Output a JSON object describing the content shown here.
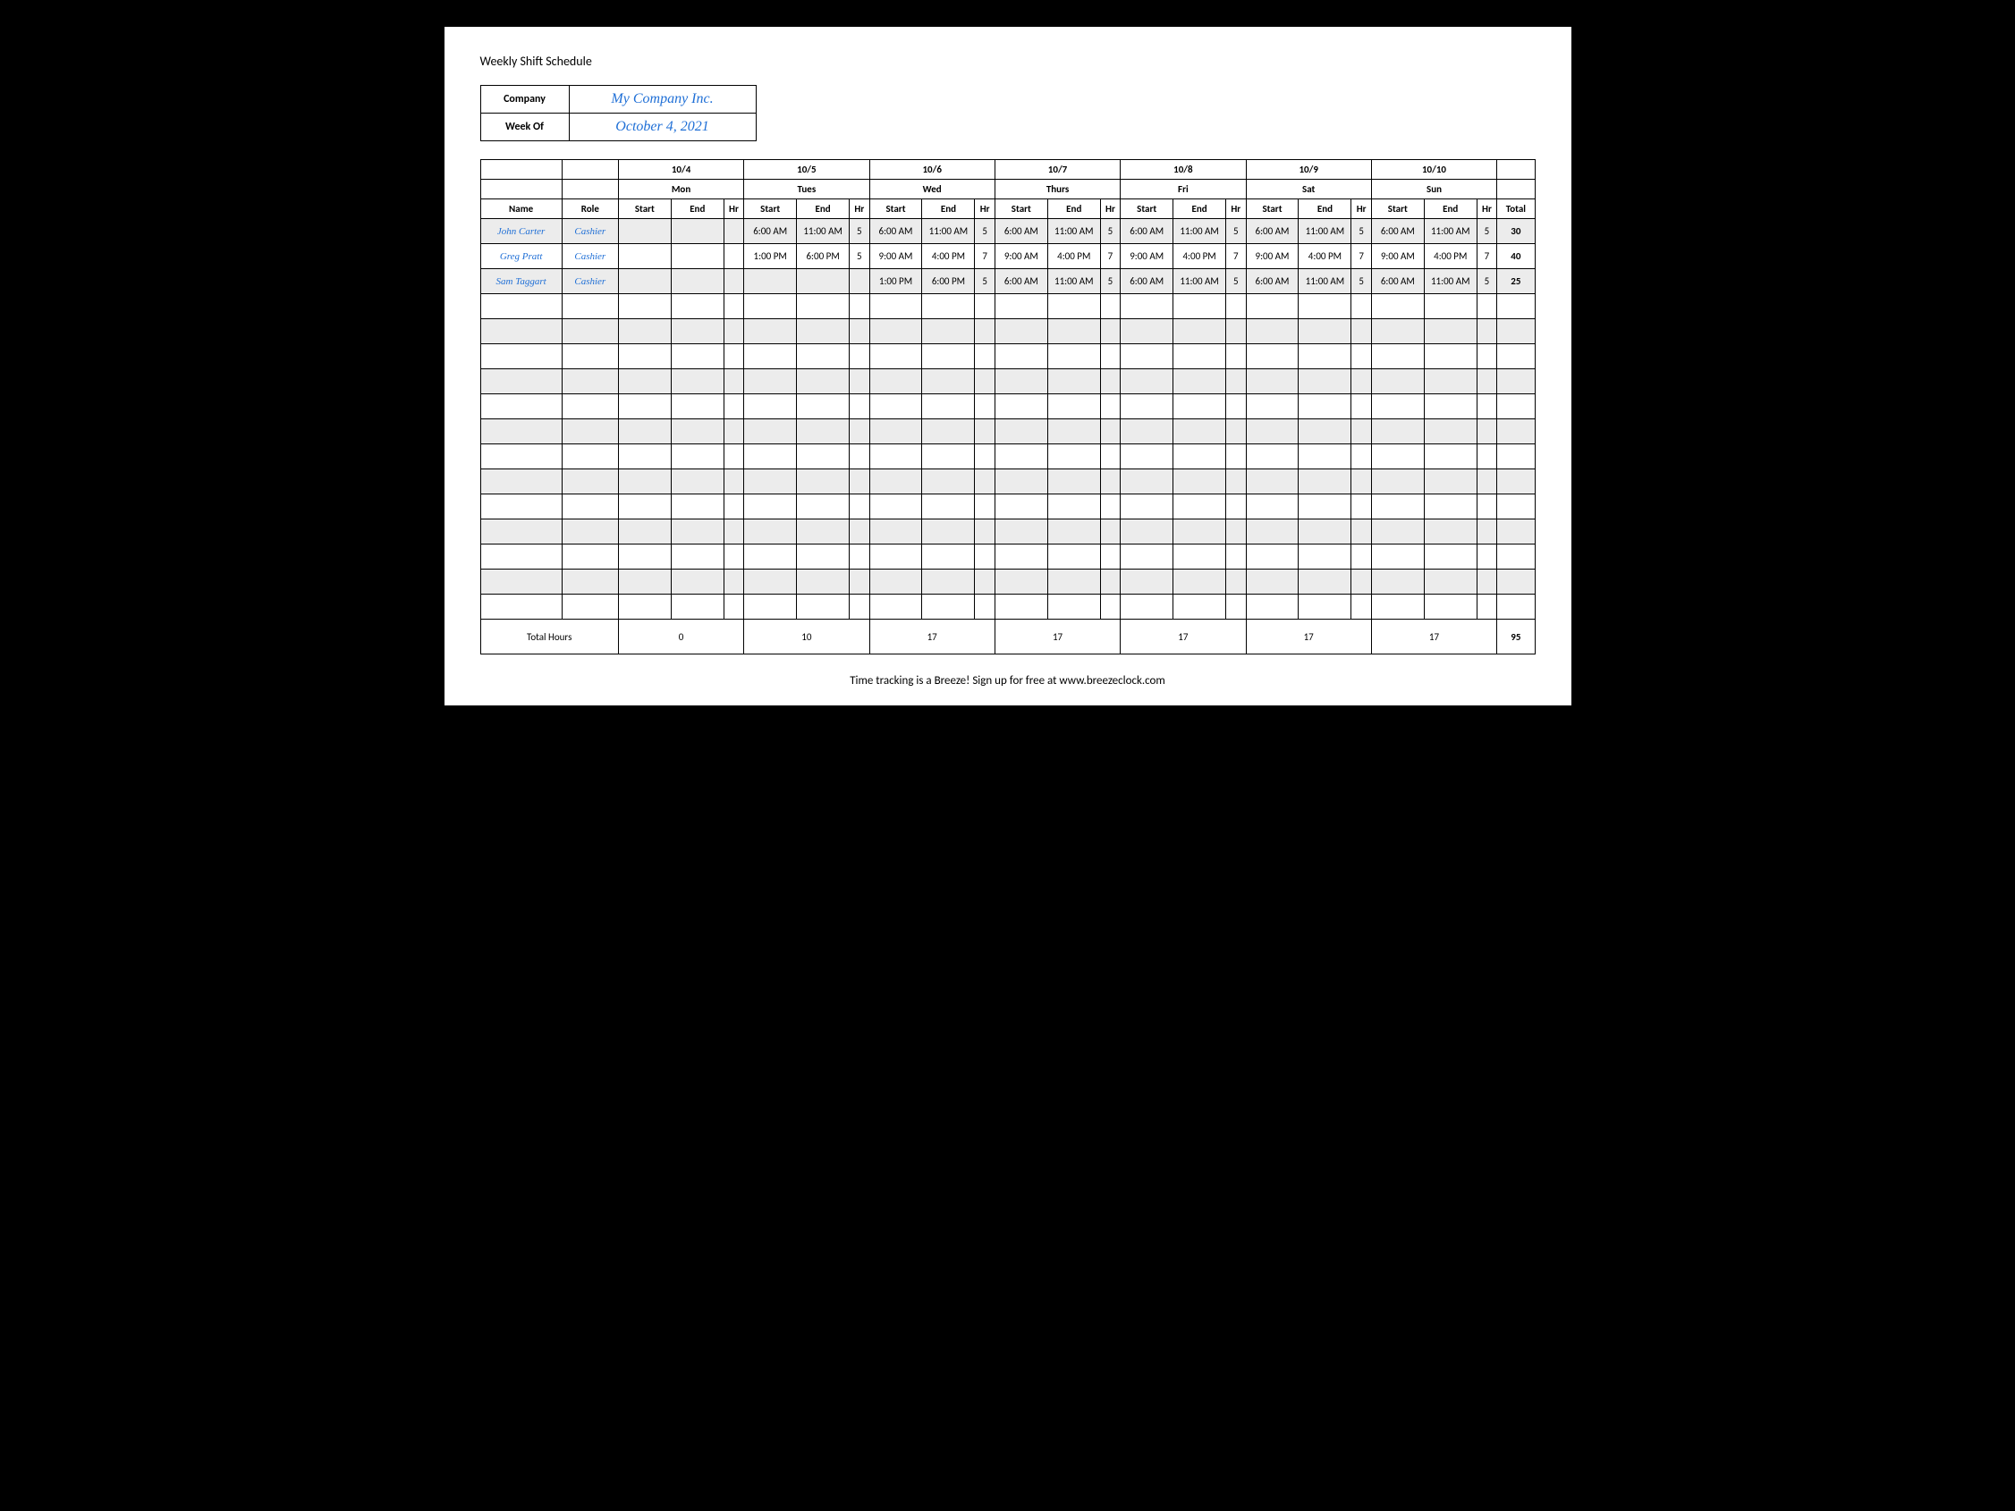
{
  "title": "Weekly Shift Schedule",
  "meta": {
    "company_label": "Company",
    "company_value": "My Company Inc.",
    "week_label": "Week Of",
    "week_value": "October 4, 2021"
  },
  "dates": [
    "10/4",
    "10/5",
    "10/6",
    "10/7",
    "10/8",
    "10/9",
    "10/10"
  ],
  "daynames": [
    "Mon",
    "Tues",
    "Wed",
    "Thurs",
    "Fri",
    "Sat",
    "Sun"
  ],
  "col_headers": {
    "name": "Name",
    "role": "Role",
    "start": "Start",
    "end": "End",
    "hr": "Hr",
    "total": "Total"
  },
  "employees": [
    {
      "name": "John Carter",
      "role": "Cashier",
      "days": [
        {
          "start": "",
          "end": "",
          "hr": ""
        },
        {
          "start": "6:00 AM",
          "end": "11:00 AM",
          "hr": "5"
        },
        {
          "start": "6:00 AM",
          "end": "11:00 AM",
          "hr": "5"
        },
        {
          "start": "6:00 AM",
          "end": "11:00 AM",
          "hr": "5"
        },
        {
          "start": "6:00 AM",
          "end": "11:00 AM",
          "hr": "5"
        },
        {
          "start": "6:00 AM",
          "end": "11:00 AM",
          "hr": "5"
        },
        {
          "start": "6:00 AM",
          "end": "11:00 AM",
          "hr": "5"
        }
      ],
      "total": "30"
    },
    {
      "name": "Greg Pratt",
      "role": "Cashier",
      "days": [
        {
          "start": "",
          "end": "",
          "hr": ""
        },
        {
          "start": "1:00 PM",
          "end": "6:00 PM",
          "hr": "5"
        },
        {
          "start": "9:00 AM",
          "end": "4:00 PM",
          "hr": "7"
        },
        {
          "start": "9:00 AM",
          "end": "4:00 PM",
          "hr": "7"
        },
        {
          "start": "9:00 AM",
          "end": "4:00 PM",
          "hr": "7"
        },
        {
          "start": "9:00 AM",
          "end": "4:00 PM",
          "hr": "7"
        },
        {
          "start": "9:00 AM",
          "end": "4:00 PM",
          "hr": "7"
        }
      ],
      "total": "40"
    },
    {
      "name": "Sam Taggart",
      "role": "Cashier",
      "days": [
        {
          "start": "",
          "end": "",
          "hr": ""
        },
        {
          "start": "",
          "end": "",
          "hr": ""
        },
        {
          "start": "1:00 PM",
          "end": "6:00 PM",
          "hr": "5"
        },
        {
          "start": "6:00 AM",
          "end": "11:00 AM",
          "hr": "5"
        },
        {
          "start": "6:00 AM",
          "end": "11:00 AM",
          "hr": "5"
        },
        {
          "start": "6:00 AM",
          "end": "11:00 AM",
          "hr": "5"
        },
        {
          "start": "6:00 AM",
          "end": "11:00 AM",
          "hr": "5"
        }
      ],
      "total": "25"
    }
  ],
  "empty_rows": 13,
  "totals": {
    "label": "Total Hours",
    "per_day": [
      "0",
      "10",
      "17",
      "17",
      "17",
      "17",
      "17"
    ],
    "grand": "95"
  },
  "footer": "Time tracking is a Breeze! Sign up for free at www.breezeclock.com"
}
